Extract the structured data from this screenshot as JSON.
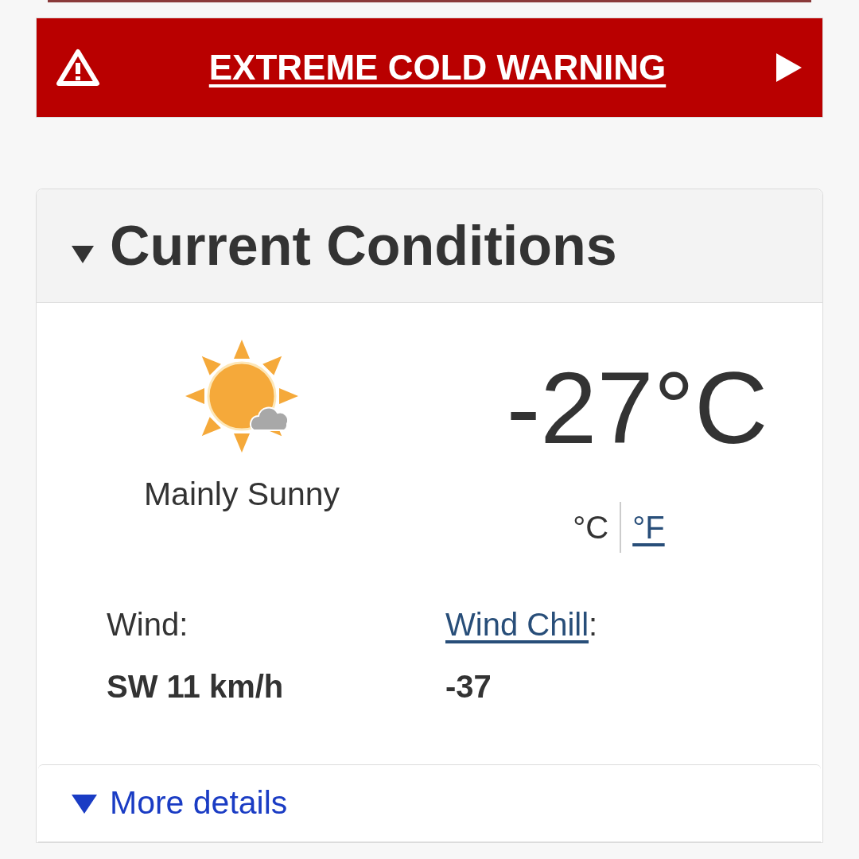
{
  "warning_banner": {
    "title": "EXTREME COLD WARNING"
  },
  "current_conditions": {
    "title": "Current Conditions",
    "expanded": true,
    "condition": "Mainly Sunny",
    "temperature": "-27°C",
    "units": [
      {
        "label": "°C",
        "selected": true
      },
      {
        "label": "°F",
        "selected": false
      }
    ],
    "details": [
      {
        "kind": "plain",
        "label": "Wind:",
        "value": "SW 11 km/h"
      },
      {
        "kind": "link",
        "label": "Wind Chill",
        "suffix": ":",
        "value": "-37"
      }
    ],
    "more_details": {
      "label": "More details",
      "expanded": false
    }
  }
}
